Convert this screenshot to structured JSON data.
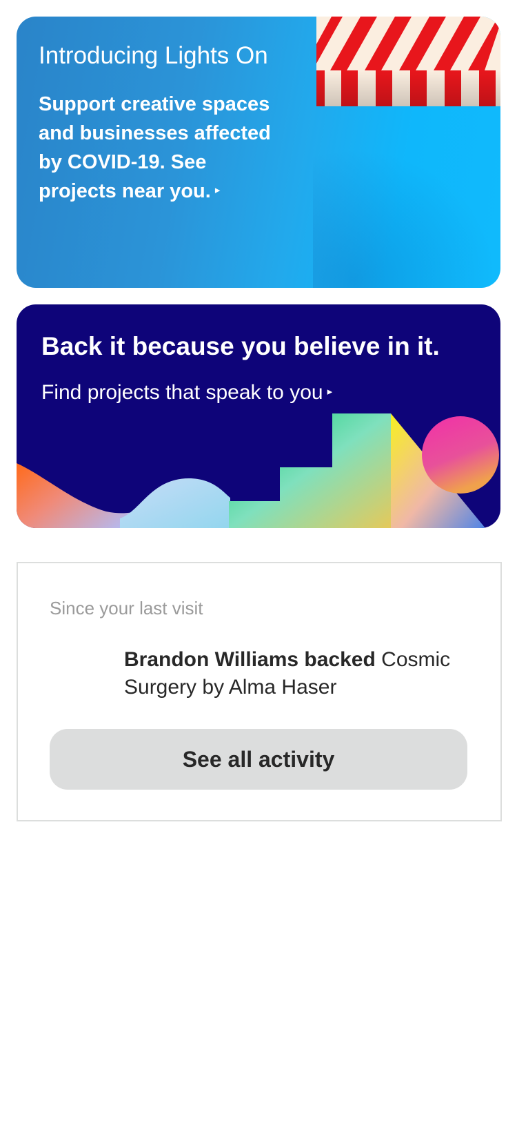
{
  "lights_on_card": {
    "title": "Introducing Lights On",
    "body": "Support creative spaces and businesses affected by COVID-19. See projects near you.",
    "arrow": "▸",
    "colors": {
      "background": "#22a9ec",
      "awning_red": "#e8161c",
      "awning_cream": "#fbeee0"
    }
  },
  "back_it_card": {
    "headline": "Back it because you believe in it.",
    "subtext": "Find projects that speak to you",
    "arrow": "▸",
    "colors": {
      "background": "#0e0479"
    }
  },
  "activity": {
    "section_label": "Since your last visit",
    "items": [
      {
        "actor": "Brandon Williams backed",
        "project": "Cosmic Surgery by Alma Haser"
      }
    ],
    "see_all_button": "See all activity"
  }
}
